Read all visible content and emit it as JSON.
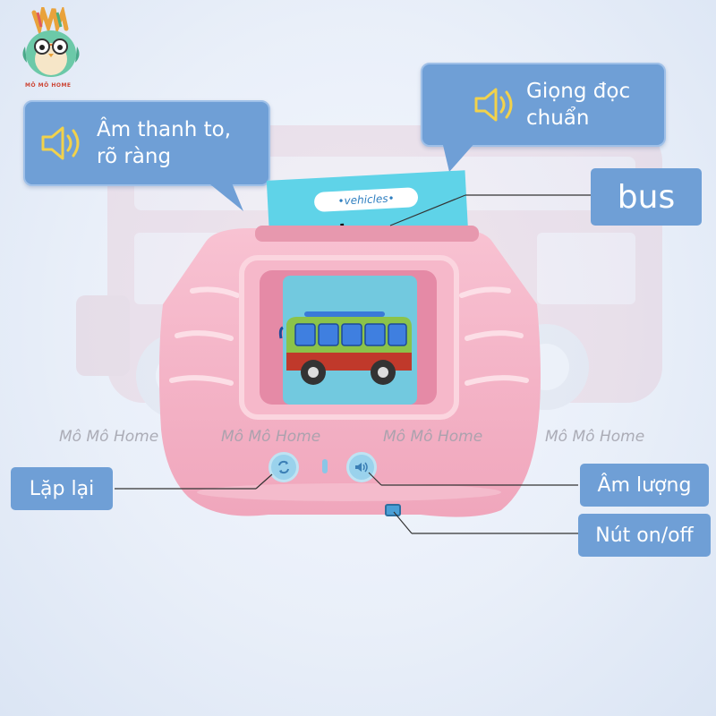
{
  "brand": {
    "logo_text": "MÔ MÔ HOME"
  },
  "callouts": {
    "left": {
      "line1": "Âm thanh to,",
      "line2": "rõ ràng",
      "icon": "speaker-icon"
    },
    "right": {
      "line1": "Giọng đọc",
      "line2": "chuẩn",
      "icon": "speaker-icon"
    }
  },
  "card": {
    "category": "vehicles",
    "word": "bus"
  },
  "labels": {
    "word": "bus",
    "repeat": "Lặp lại",
    "volume": "Âm lượng",
    "power": "Nút on/off"
  },
  "watermarks": [
    "Mô Mô Home",
    "Mô Mô Home",
    "Mô Mô Home",
    "Mô Mô Home"
  ],
  "colors": {
    "callout_blue": "#6f9fd6",
    "device_pink": "#f4b3c6",
    "card_cyan": "#5fd3e8"
  }
}
